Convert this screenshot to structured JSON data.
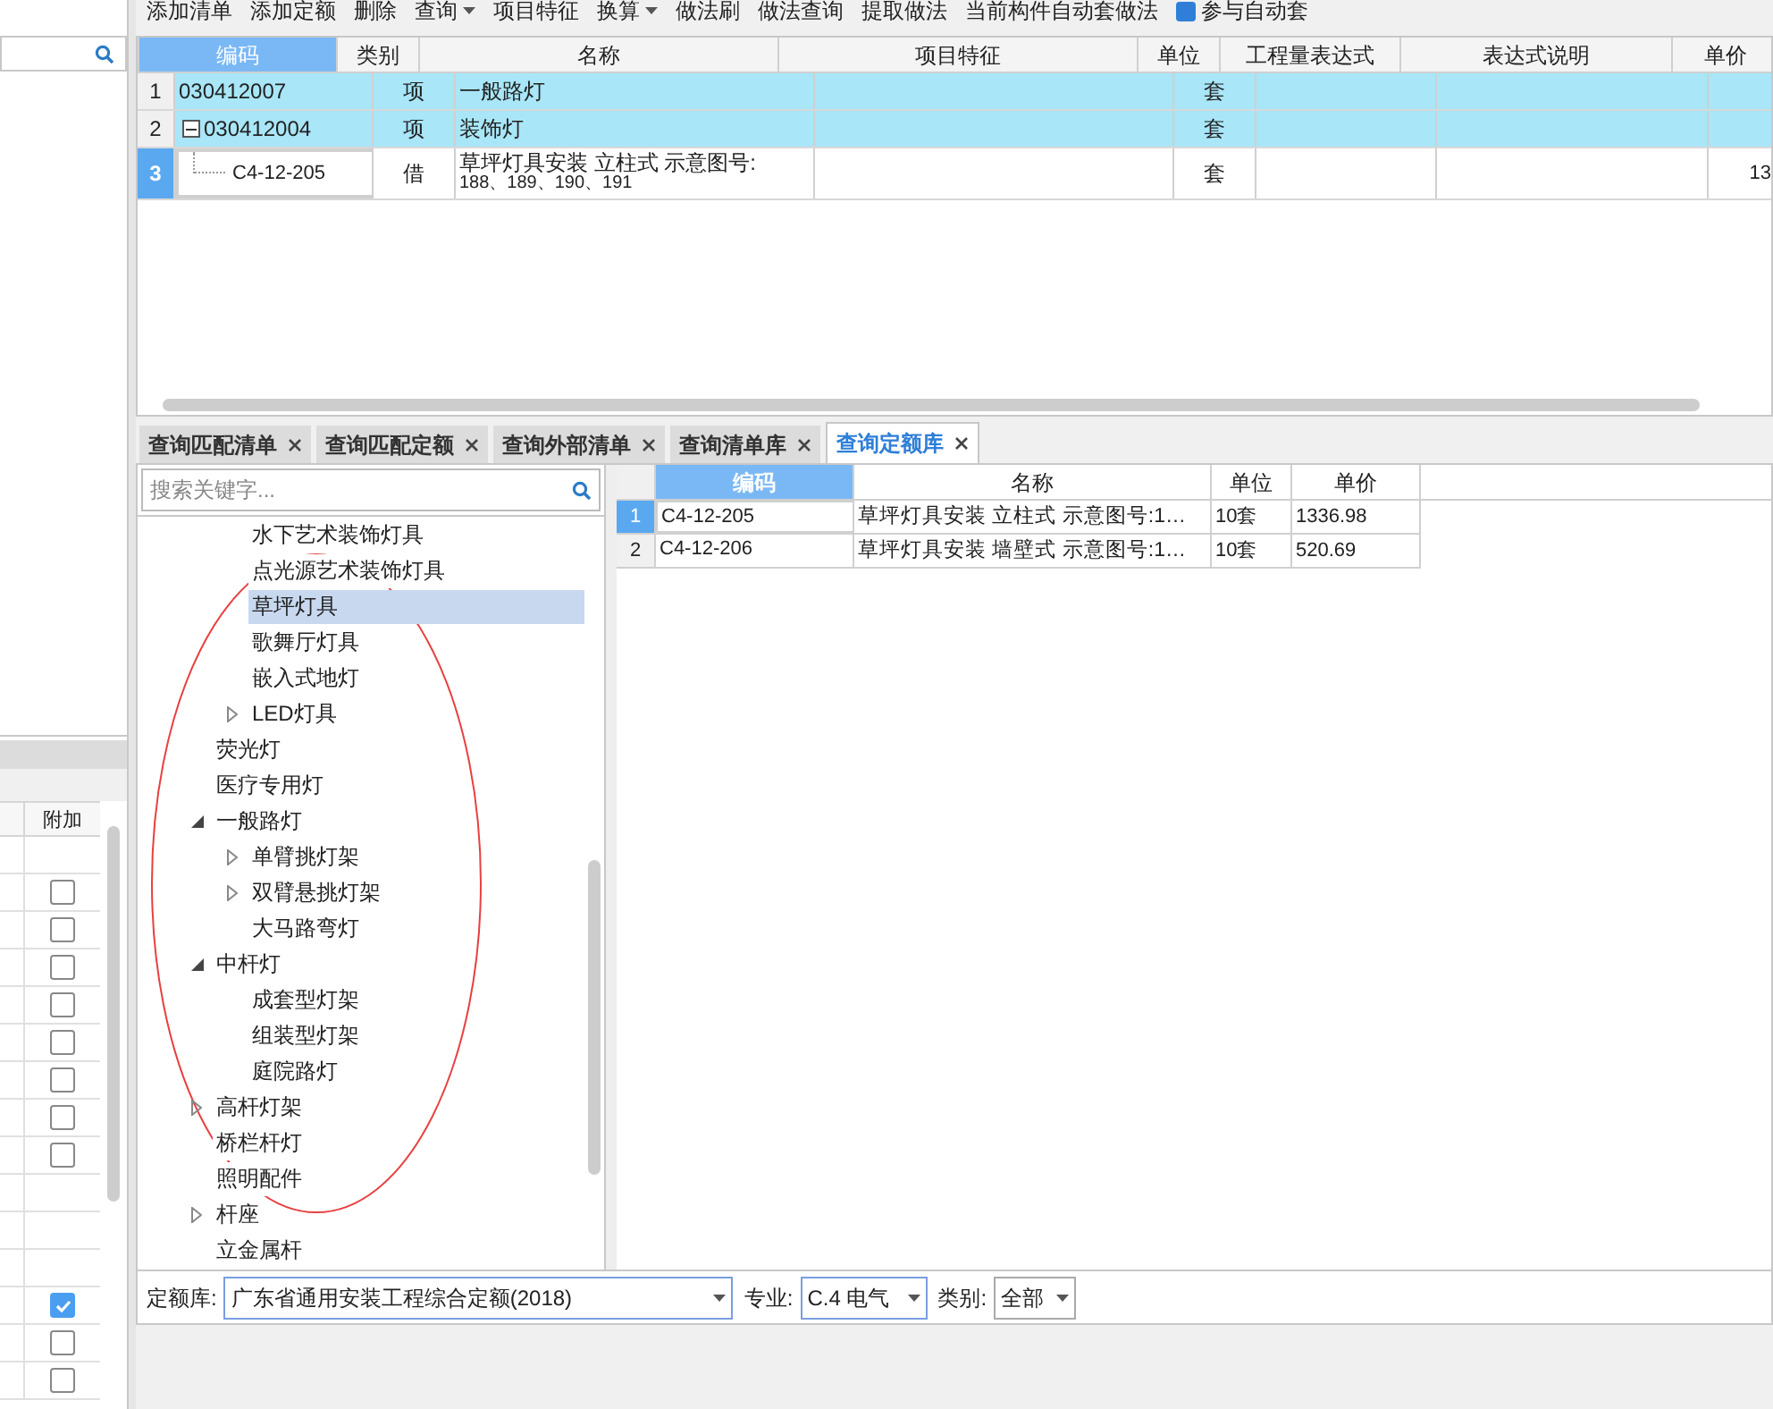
{
  "toolbar": [
    {
      "kind": "button",
      "label": "添加清单"
    },
    {
      "kind": "button",
      "label": "添加定额"
    },
    {
      "kind": "button",
      "label": "删除"
    },
    {
      "kind": "dropdown",
      "label": "查询"
    },
    {
      "kind": "button",
      "label": "项目特征"
    },
    {
      "kind": "dropdown",
      "label": "换算"
    },
    {
      "kind": "button",
      "label": "做法刷"
    },
    {
      "kind": "button",
      "label": "做法查询"
    },
    {
      "kind": "button",
      "label": "提取做法"
    },
    {
      "kind": "button",
      "label": "当前构件自动套做法"
    },
    {
      "kind": "checkbox",
      "label": "参与自动套",
      "checked": true
    }
  ],
  "left_panel": {
    "extra_header": "附加",
    "rows": [
      {
        "kind": "blank"
      },
      {
        "kind": "checkbox",
        "checked": false
      },
      {
        "kind": "checkbox",
        "checked": false
      },
      {
        "kind": "checkbox",
        "checked": false
      },
      {
        "kind": "checkbox",
        "checked": false
      },
      {
        "kind": "checkbox",
        "checked": false
      },
      {
        "kind": "checkbox",
        "checked": false
      },
      {
        "kind": "checkbox",
        "checked": false
      },
      {
        "kind": "checkbox",
        "checked": false
      },
      {
        "kind": "blank"
      },
      {
        "kind": "blank"
      },
      {
        "kind": "blank"
      },
      {
        "kind": "checkbox",
        "checked": true
      },
      {
        "kind": "checkbox",
        "checked": false
      },
      {
        "kind": "checkbox",
        "checked": false
      }
    ]
  },
  "main_table": {
    "columns": [
      "编码",
      "类别",
      "名称",
      "项目特征",
      "单位",
      "工程量表达式",
      "表达式说明",
      "单价"
    ],
    "rows": [
      {
        "num": "1",
        "code": "030412007",
        "collapse": false,
        "tree_child": false,
        "type": "项",
        "name": "一般路灯",
        "unit": "套",
        "price": "",
        "highlighted": true,
        "selected": false
      },
      {
        "num": "2",
        "code": "030412004",
        "collapse": true,
        "tree_child": false,
        "type": "项",
        "name": "装饰灯",
        "unit": "套",
        "price": "",
        "highlighted": true,
        "selected": false
      },
      {
        "num": "3",
        "code": "C4-12-205",
        "collapse": false,
        "tree_child": true,
        "type": "借",
        "name": "草坪灯具安装 立柱式 示意图号:",
        "name_line2": "188、189、190、191",
        "unit": "套",
        "price": "13",
        "highlighted": false,
        "selected": true
      }
    ]
  },
  "tabs": [
    {
      "label": "查询匹配清单",
      "selected": false
    },
    {
      "label": "查询匹配定额",
      "selected": false
    },
    {
      "label": "查询外部清单",
      "selected": false
    },
    {
      "label": "查询清单库",
      "selected": false
    },
    {
      "label": "查询定额库",
      "selected": true
    }
  ],
  "search": {
    "placeholder": "搜索关键字..."
  },
  "tree": {
    "continued_children": [
      {
        "label": "水下艺术装饰灯具",
        "selected": false
      },
      {
        "label": "点光源艺术装饰灯具",
        "selected": false
      },
      {
        "label": "草坪灯具",
        "selected": true
      },
      {
        "label": "歌舞厅灯具",
        "selected": false
      },
      {
        "label": "嵌入式地灯",
        "selected": false
      },
      {
        "label": "LED灯具",
        "selected": false,
        "expanded": false
      }
    ],
    "items": [
      {
        "label": "荧光灯",
        "selected": false
      },
      {
        "label": "医疗专用灯",
        "selected": false
      },
      {
        "label": "一般路灯",
        "selected": false,
        "expanded": true,
        "children": [
          {
            "label": "单臂挑灯架",
            "selected": false,
            "expanded": false
          },
          {
            "label": "双臂悬挑灯架",
            "selected": false,
            "expanded": false
          },
          {
            "label": "大马路弯灯",
            "selected": false
          }
        ]
      },
      {
        "label": "中杆灯",
        "selected": false,
        "expanded": true,
        "children": [
          {
            "label": "成套型灯架",
            "selected": false
          },
          {
            "label": "组装型灯架",
            "selected": false
          },
          {
            "label": "庭院路灯",
            "selected": false
          }
        ]
      },
      {
        "label": "高杆灯架",
        "selected": false,
        "expanded": false
      },
      {
        "label": "桥栏杆灯",
        "selected": false
      },
      {
        "label": "照明配件",
        "selected": false
      },
      {
        "label": "杆座",
        "selected": false,
        "expanded": false
      },
      {
        "label": "立金属杆",
        "selected": false
      }
    ]
  },
  "quota_table": {
    "columns": [
      "编码",
      "名称",
      "单位",
      "单价"
    ],
    "rows": [
      {
        "num": "1",
        "code": "C4-12-205",
        "name": "草坪灯具安装 立柱式 示意图号:1…",
        "unit": "10套",
        "price": "1336.98",
        "selected": true
      },
      {
        "num": "2",
        "code": "C4-12-206",
        "name": "草坪灯具安装 墙壁式 示意图号:1…",
        "unit": "10套",
        "price": "520.69",
        "selected": false
      }
    ]
  },
  "filters": {
    "library_label": "定额库:",
    "library": "广东省通用安装工程综合定额(2018)",
    "major_label": "专业:",
    "major": "C.4 电气",
    "category_label": "类别:",
    "category": "全部"
  }
}
